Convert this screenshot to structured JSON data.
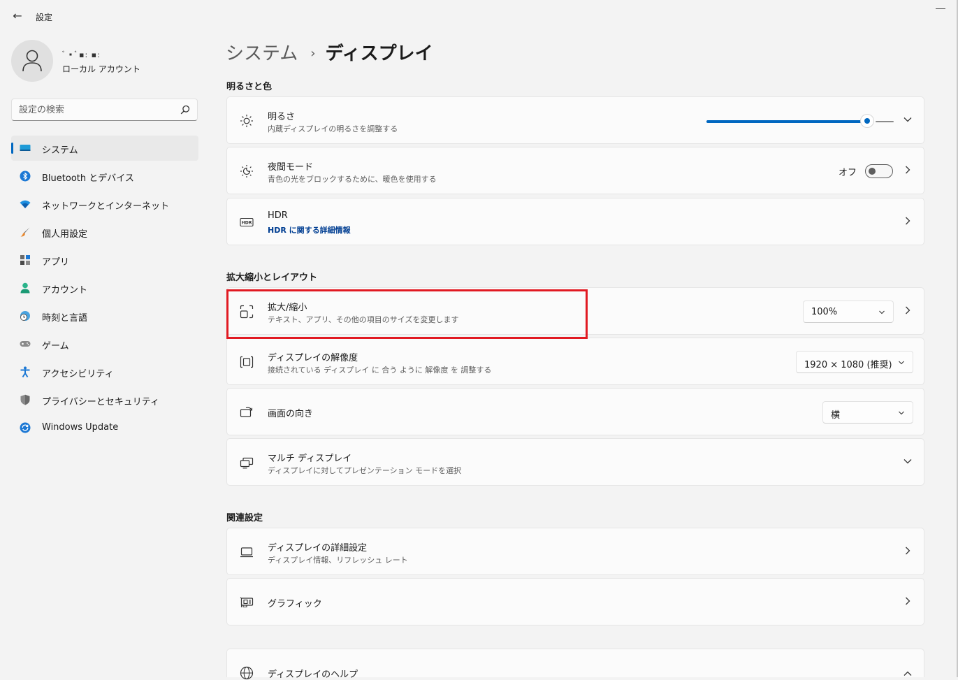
{
  "window": {
    "title": "設定",
    "back_label": "←"
  },
  "user": {
    "name": "ﾞ▪ﾞ▪: ▪:",
    "account_type": "ローカル アカウント"
  },
  "search": {
    "placeholder": "設定の検索"
  },
  "sidebar": {
    "items": [
      {
        "label": "システム",
        "icon": "system-icon",
        "active": true
      },
      {
        "label": "Bluetooth とデバイス",
        "icon": "bluetooth-icon"
      },
      {
        "label": "ネットワークとインターネット",
        "icon": "wifi-icon"
      },
      {
        "label": "個人用設定",
        "icon": "brush-icon"
      },
      {
        "label": "アプリ",
        "icon": "apps-icon"
      },
      {
        "label": "アカウント",
        "icon": "account-icon"
      },
      {
        "label": "時刻と言語",
        "icon": "clock-globe-icon"
      },
      {
        "label": "ゲーム",
        "icon": "gamepad-icon"
      },
      {
        "label": "アクセシビリティ",
        "icon": "accessibility-icon"
      },
      {
        "label": "プライバシーとセキュリティ",
        "icon": "shield-icon"
      },
      {
        "label": "Windows Update",
        "icon": "windows-update-icon"
      }
    ]
  },
  "breadcrumb": {
    "parent": "システム",
    "separator": "›",
    "current": "ディスプレイ"
  },
  "sections": {
    "brightness_color": {
      "title": "明るさと色",
      "brightness": {
        "title": "明るさ",
        "subtitle": "内蔵ディスプレイの明るさを調整する",
        "value_fraction": 0.86
      },
      "night_light": {
        "title": "夜間モード",
        "subtitle": "青色の光をブロックするために、暖色を使用する",
        "toggle_label": "オフ"
      },
      "hdr": {
        "title": "HDR",
        "link": "HDR に関する詳細情報",
        "icon_text": "HDR"
      }
    },
    "scale_layout": {
      "title": "拡大縮小とレイアウト",
      "scale": {
        "title": "拡大/縮小",
        "subtitle": "テキスト、アプリ、その他の項目のサイズを変更します",
        "value": "100%"
      },
      "resolution": {
        "title": "ディスプレイの解像度",
        "subtitle": "接続されている ディスプレイ に 合う ように 解像度 を 調整する",
        "value": "1920 × 1080 (推奨)"
      },
      "orientation": {
        "title": "画面の向き",
        "value": "横"
      },
      "multi_display": {
        "title": "マルチ ディスプレイ",
        "subtitle": "ディスプレイに対してプレゼンテーション モードを選択"
      }
    },
    "related": {
      "title": "関連設定",
      "advanced_display": {
        "title": "ディスプレイの詳細設定",
        "subtitle": "ディスプレイ情報、リフレッシュ レート"
      },
      "graphics": {
        "title": "グラフィック"
      },
      "display_help": {
        "title": "ディスプレイのヘルプ"
      }
    }
  },
  "colors": {
    "accent": "#0067c0",
    "highlight_box": "#e11a22"
  }
}
